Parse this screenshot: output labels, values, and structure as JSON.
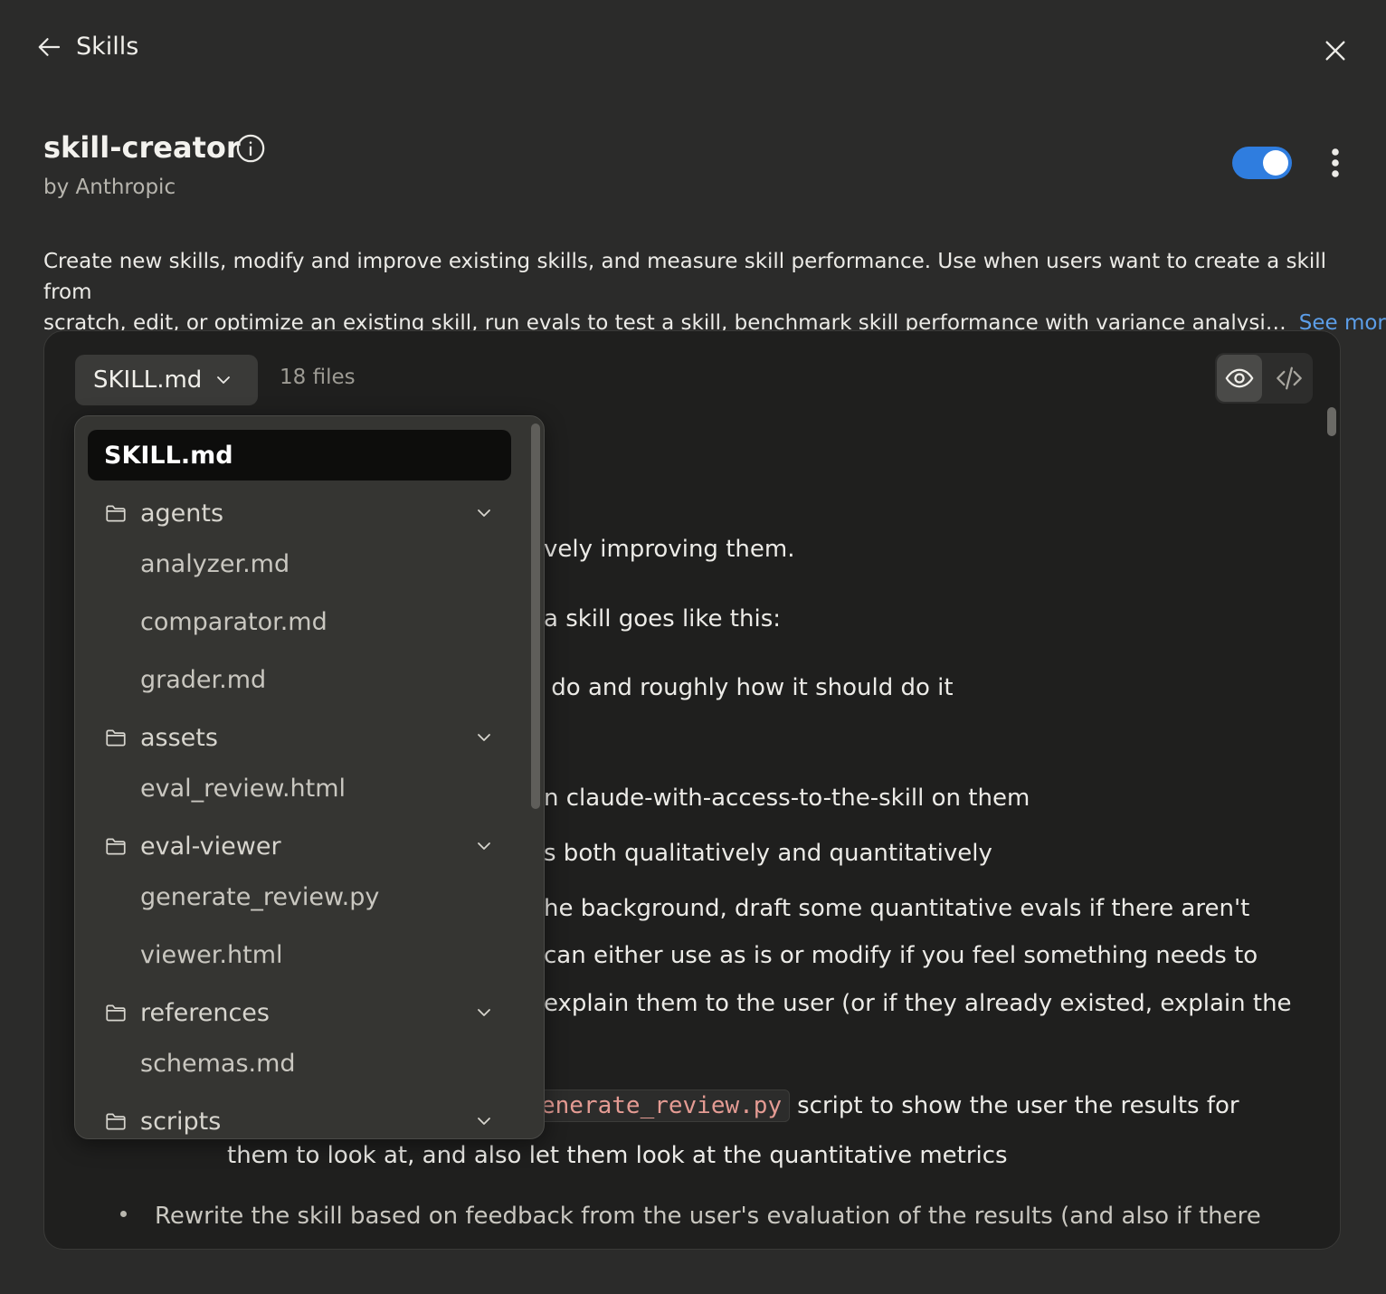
{
  "header": {
    "title": "Skills"
  },
  "skill": {
    "name": "skill-creator",
    "author": "by Anthropic",
    "enabled": true,
    "description_line1": "Create new skills, modify and improve existing skills, and measure skill performance. Use when users want to create a skill from",
    "description_line2": "scratch, edit, or optimize an existing skill, run evals to test a skill, benchmark skill performance with variance analysi…",
    "see_more": "See more"
  },
  "viewer": {
    "selected_file": "SKILL.md",
    "file_count": "18 files",
    "content": {
      "line1": "vely improving them.",
      "line2": "a skill goes like this:",
      "line3": " do and roughly how it should do it",
      "line4": "n claude-with-access-to-the-skill on them",
      "line5": "s both qualitatively and quantitatively",
      "line6": "he background, draft some quantitative evals if there aren't",
      "line7": "can either use as is or modify if you feel something needs to",
      "line8": "explain them to the user (or if they already existed, explain the",
      "code": "enerate_review.py",
      "line9_after_code": "script to show the user the results for",
      "line10": "them to look at, and also let them look at the quantitative metrics",
      "bullet": "Rewrite the skill based on feedback from the user's evaluation of the results (and also if there"
    }
  },
  "dropdown": {
    "selected": "SKILL.md",
    "folders": [
      {
        "name": "agents",
        "files": [
          "analyzer.md",
          "comparator.md",
          "grader.md"
        ]
      },
      {
        "name": "assets",
        "files": [
          "eval_review.html"
        ]
      },
      {
        "name": "eval-viewer",
        "files": [
          "generate_review.py",
          "viewer.html"
        ]
      },
      {
        "name": "references",
        "files": [
          "schemas.md"
        ]
      },
      {
        "name": "scripts",
        "files": []
      }
    ]
  },
  "colors": {
    "accent": "#2f7ddf",
    "link": "#5c9ee8",
    "code": "#e49b93"
  }
}
